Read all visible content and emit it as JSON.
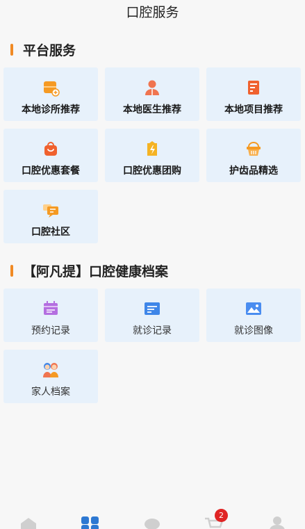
{
  "header": {
    "title": "口腔服务"
  },
  "platform": {
    "title": "平台服务",
    "items": [
      {
        "label": "本地诊所推荐",
        "icon": "clinic-icon"
      },
      {
        "label": "本地医生推荐",
        "icon": "doctor-icon"
      },
      {
        "label": "本地项目推荐",
        "icon": "project-icon"
      },
      {
        "label": "口腔优惠套餐",
        "icon": "package-bag-icon"
      },
      {
        "label": "口腔优惠团购",
        "icon": "group-buy-icon"
      },
      {
        "label": "护齿品精选",
        "icon": "basket-icon"
      },
      {
        "label": "口腔社区",
        "icon": "community-chat-icon"
      }
    ]
  },
  "records": {
    "title": "【阿凡提】口腔健康档案",
    "items": [
      {
        "label": "预约记录",
        "icon": "calendar-icon"
      },
      {
        "label": "就诊记录",
        "icon": "record-list-icon"
      },
      {
        "label": "就诊图像",
        "icon": "image-icon"
      },
      {
        "label": "家人档案",
        "icon": "family-icon"
      }
    ]
  },
  "tabbar": {
    "items": [
      {
        "icon": "home-icon"
      },
      {
        "icon": "services-icon",
        "active": true
      },
      {
        "icon": "message-icon"
      },
      {
        "icon": "cart-icon",
        "badge": "2"
      },
      {
        "icon": "profile-icon"
      }
    ]
  },
  "colors": {
    "accent": "#f08a24",
    "tile_bg": "#e7f1fb",
    "active_tab": "#2d78d2",
    "badge": "#e02424"
  }
}
